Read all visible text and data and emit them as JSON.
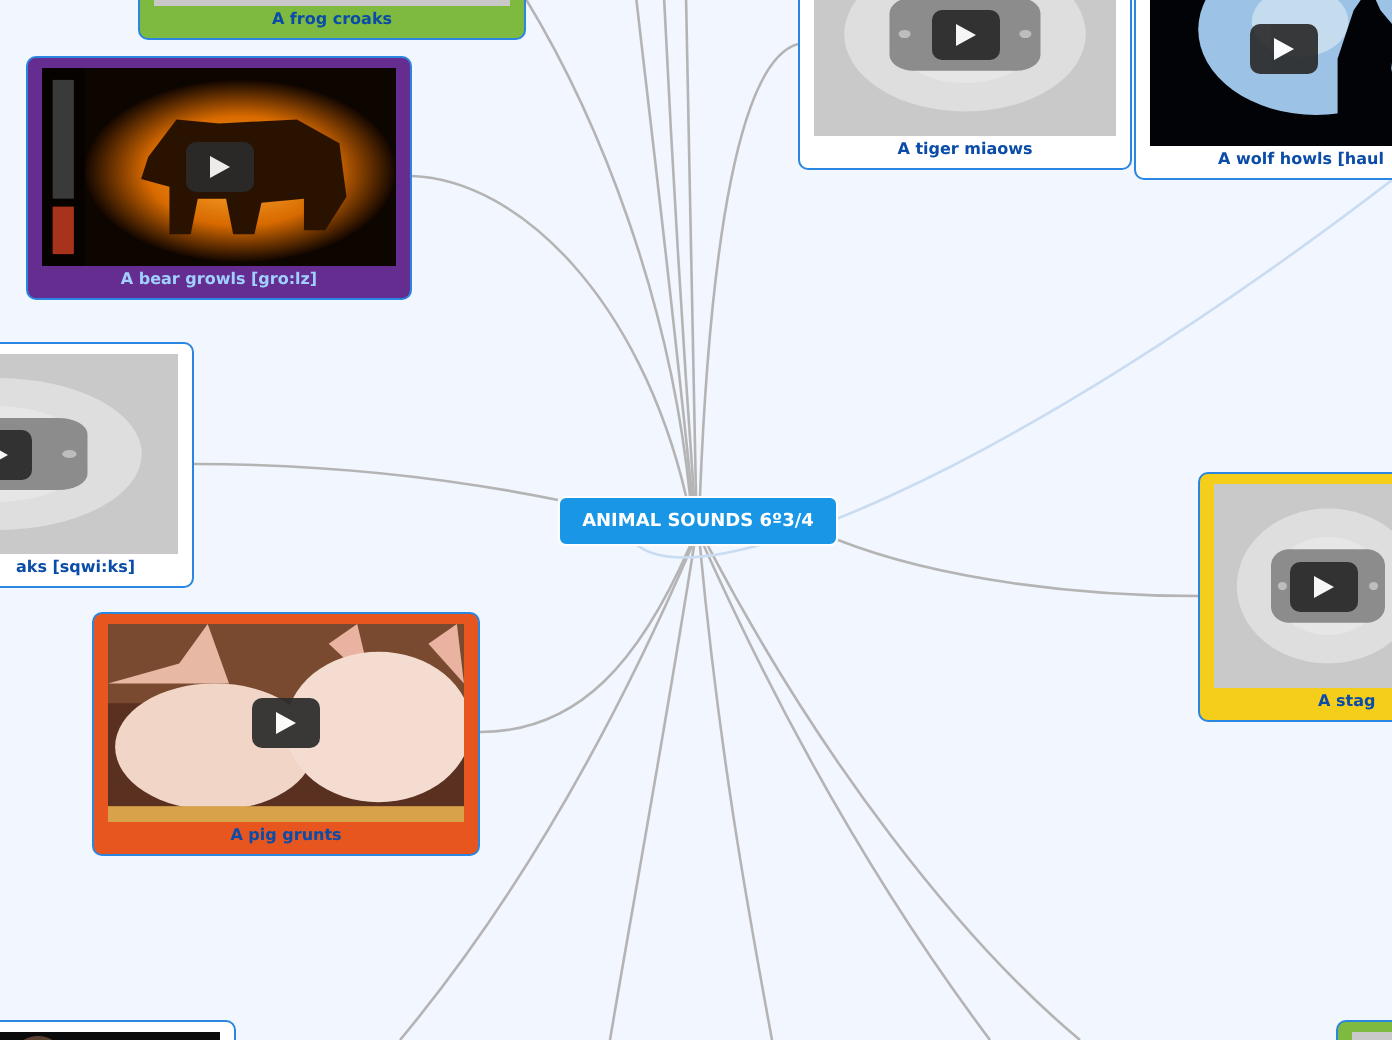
{
  "central_topic": {
    "label": "ANIMAL SOUNDS 6º3/4"
  },
  "nodes": [
    {
      "label": "A frog croaks",
      "color": "#7dba3f"
    },
    {
      "label": "A bear growls [gro:lz]",
      "color": "#662d91"
    },
    {
      "label": "A tiger miaows",
      "color": "#ffffff"
    },
    {
      "label": "A wolf howls [haul",
      "color": "#ffffff"
    },
    {
      "label": "aks [sqwi:ks]",
      "color": "#ffffff"
    },
    {
      "label": "A stag",
      "color": "#f5cd1b"
    },
    {
      "label": "A pig grunts",
      "color": "#e8561f"
    },
    {
      "color": "#ffffff"
    },
    {
      "color": "#7dba3f"
    }
  ]
}
